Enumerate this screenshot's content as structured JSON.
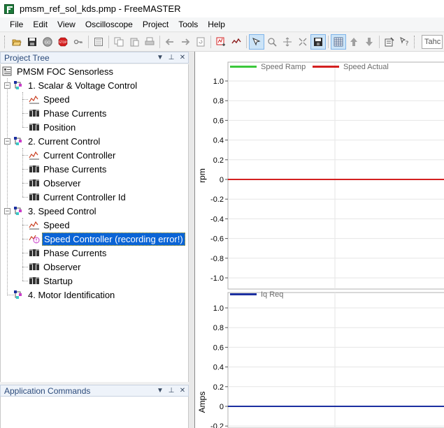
{
  "window": {
    "title": "pmsm_ref_sol_kds.pmp - FreeMASTER",
    "app_icon": "freemaster-icon"
  },
  "menu": [
    "File",
    "Edit",
    "View",
    "Oscilloscope",
    "Project",
    "Tools",
    "Help"
  ],
  "toolbar": {
    "combo_value": "Tahc"
  },
  "project_tree": {
    "title": "Project Tree",
    "root": "PMSM FOC Sensorless",
    "groups": [
      {
        "label": "1. Scalar & Voltage Control",
        "items": [
          {
            "label": "Speed",
            "icon": "recorder-icon"
          },
          {
            "label": "Phase Currents",
            "icon": "oscilloscope-icon"
          },
          {
            "label": "Position",
            "icon": "oscilloscope-icon"
          }
        ]
      },
      {
        "label": "2. Current Control",
        "items": [
          {
            "label": "Current Controller",
            "icon": "recorder-icon"
          },
          {
            "label": "Phase Currents",
            "icon": "oscilloscope-icon"
          },
          {
            "label": "Observer",
            "icon": "oscilloscope-icon"
          },
          {
            "label": "Current Controller Id",
            "icon": "oscilloscope-icon"
          }
        ]
      },
      {
        "label": "3. Speed Control",
        "items": [
          {
            "label": "Speed",
            "icon": "recorder-icon"
          },
          {
            "label": "Speed Controller (recording error!)",
            "icon": "recorder-error-icon",
            "selected": true
          },
          {
            "label": "Phase Currents",
            "icon": "oscilloscope-icon"
          },
          {
            "label": "Observer",
            "icon": "oscilloscope-icon"
          },
          {
            "label": "Startup",
            "icon": "oscilloscope-icon"
          }
        ]
      },
      {
        "label": "4. Motor Identification",
        "items": []
      }
    ]
  },
  "app_commands": {
    "title": "Application Commands"
  },
  "chart_data": [
    {
      "type": "line",
      "title": "",
      "xlabel": "",
      "ylabel": "rpm",
      "ylim": [
        -1.1,
        1.1
      ],
      "yticks": [
        "1.0",
        "0.8",
        "0.6",
        "0.4",
        "0.2",
        "0",
        "-0.2",
        "-0.4",
        "-0.6",
        "-0.8",
        "-1.0"
      ],
      "grid": true,
      "legend": "top-left",
      "series": [
        {
          "name": "Speed Ramp",
          "color": "#3cc83c",
          "values": []
        },
        {
          "name": "Speed Actual",
          "color": "#d42020",
          "values": [
            0,
            0
          ]
        }
      ]
    },
    {
      "type": "line",
      "title": "",
      "xlabel": "",
      "ylabel": "Amps",
      "ylim": [
        -0.25,
        1.1
      ],
      "yticks": [
        "1.0",
        "0.8",
        "0.6",
        "0.4",
        "0.2",
        "0",
        "-0.2"
      ],
      "grid": true,
      "legend": "top-left",
      "series": [
        {
          "name": "Iq Req",
          "color": "#1c2fa0",
          "values": [
            0,
            0
          ]
        }
      ]
    }
  ],
  "colors": {
    "selection": "#0a64d6",
    "panel_title": "#2b4a7a"
  }
}
